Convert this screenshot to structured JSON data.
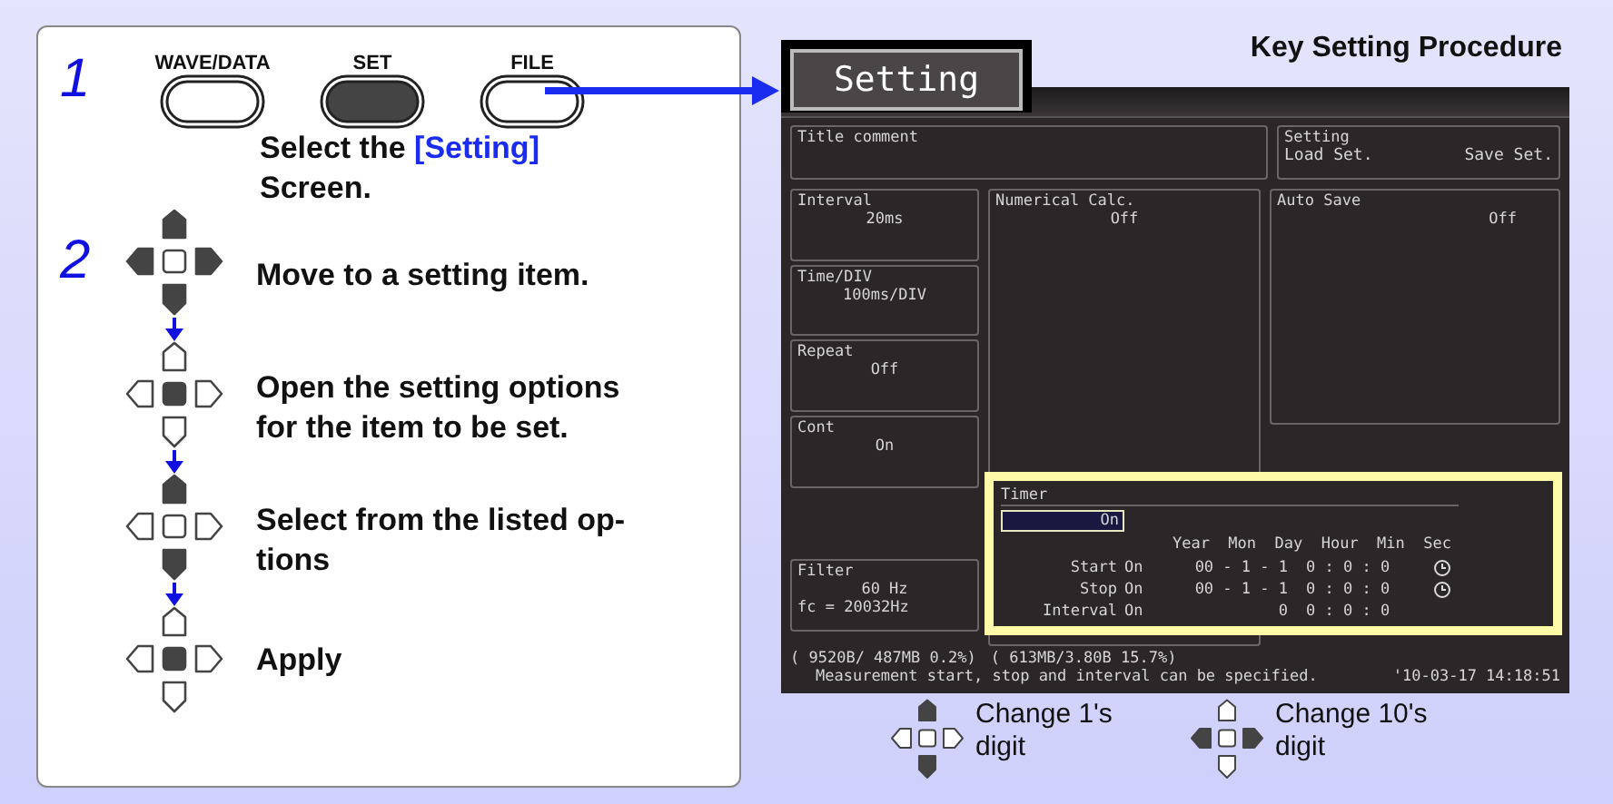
{
  "guide": {
    "step_1": {
      "number": "1",
      "keys": [
        {
          "label": "WAVE/DATA",
          "pressed": false
        },
        {
          "label": "SET",
          "pressed": true
        },
        {
          "label": "FILE",
          "pressed": false
        }
      ],
      "text": [
        {
          "t": "Select the ",
          "emphasis": false
        },
        {
          "t": "[Setting]",
          "emphasis": true
        },
        {
          "t": " Screen.",
          "emphasis": false
        }
      ]
    },
    "step_2": {
      "number": "2",
      "actions": [
        {
          "keys": {
            "up": true,
            "left": true,
            "center": false,
            "right": true,
            "down": true
          },
          "text": "Move to a setting item."
        },
        {
          "keys": {
            "up": false,
            "left": false,
            "center": true,
            "right": false,
            "down": false
          },
          "text": "Open the setting options for the item to be set."
        },
        {
          "keys": {
            "up": true,
            "left": false,
            "center": false,
            "right": false,
            "down": true
          },
          "text": "Select from the listed op-tions"
        },
        {
          "keys": {
            "up": false,
            "left": false,
            "center": true,
            "right": false,
            "down": false
          },
          "text": "Apply"
        }
      ]
    }
  },
  "title": "Key Setting Procedure",
  "screen": {
    "tab_label": "Setting",
    "title_comment": {
      "label": "Title comment"
    },
    "setting": {
      "label": "Setting",
      "buttons": [
        "Load Set.",
        "Save Set."
      ]
    },
    "left_fields": [
      {
        "label": "Interval",
        "value": "20ms"
      },
      {
        "label": "Time/DIV",
        "value": "100ms/DIV"
      },
      {
        "label": "Repeat",
        "value": "Off"
      },
      {
        "label": "Cont",
        "value": "On"
      }
    ],
    "filter": {
      "label": "Filter",
      "value": "60 Hz",
      "detail": "fc = 20032Hz"
    },
    "numerical_calc": {
      "label": "Numerical Calc.",
      "value": "Off"
    },
    "auto_save": {
      "label": "Auto Save",
      "value": "Off"
    },
    "timer": {
      "label": "Timer",
      "value": "On",
      "selected": true,
      "columns": [
        "Year",
        "Mon",
        "Day",
        "Hour",
        "Min",
        "Sec"
      ],
      "rows": [
        {
          "label": "Start",
          "value": "On",
          "date": "00 - 1 - 1",
          "time": "0 : 0 : 0",
          "clock": true
        },
        {
          "label": "Stop",
          "value": "On",
          "date": "00 - 1 - 1",
          "time": "0 : 0 : 0",
          "clock": true
        },
        {
          "label": "Interval",
          "value": "On",
          "date": "0",
          "time": "0 : 0 : 0",
          "clock": false
        }
      ]
    },
    "status": {
      "memory_1": "( 9520B/ 487MB  0.2%)",
      "memory_2": "( 613MB/3.80B 15.7%)",
      "message": "Measurement start, stop and interval can be specified.",
      "datetime": "'10-03-17 14:18:51"
    }
  },
  "legend": [
    {
      "keys": {
        "up": true,
        "left": false,
        "center": false,
        "right": false,
        "down": true
      },
      "text": "Change 1's digit"
    },
    {
      "keys": {
        "up": false,
        "left": true,
        "center": false,
        "right": true,
        "down": false
      },
      "text": "Change 10's digit"
    }
  ]
}
